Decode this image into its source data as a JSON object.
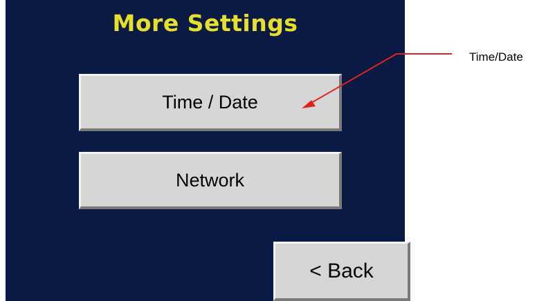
{
  "screen": {
    "title": "More Settings",
    "buttons": {
      "time_date": "Time / Date",
      "network": "Network",
      "back": "< Back"
    }
  },
  "callout": {
    "label": "Time/Date",
    "color": "#e0231f"
  },
  "colors": {
    "screen_background": "#0b1a45",
    "title": "#e6e02a",
    "button_face": "#d6d6d6"
  }
}
